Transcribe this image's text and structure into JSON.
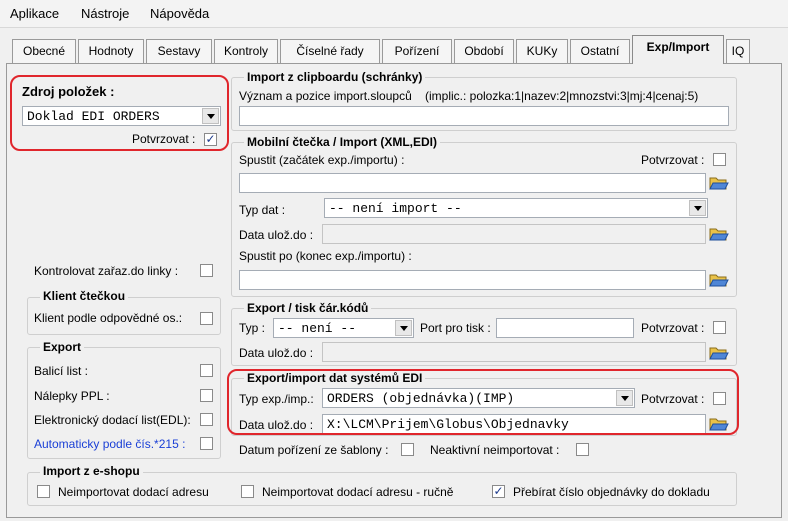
{
  "menu": {
    "items": [
      "Aplikace",
      "Nástroje",
      "Nápověda"
    ]
  },
  "tabs": [
    {
      "label": "Obecné"
    },
    {
      "label": "Hodnoty"
    },
    {
      "label": "Sestavy"
    },
    {
      "label": "Kontroly"
    },
    {
      "label": "Číselné řady"
    },
    {
      "label": "Pořízení"
    },
    {
      "label": "Období"
    },
    {
      "label": "KUKy"
    },
    {
      "label": "Ostatní"
    },
    {
      "label": "Exp/Import"
    },
    {
      "label": "IQ"
    }
  ],
  "zdroj": {
    "title": "Zdroj položek :",
    "value": "Doklad EDI ORDERS",
    "confirm_label": "Potvrzovat :",
    "confirm_checked": true
  },
  "left": {
    "kontrolovat_label": "Kontrolovat zařaz.do linky :",
    "klient": {
      "title": "Klient čtečkou",
      "option_label": "Klient podle odpovědné os.:"
    },
    "export": {
      "title": "Export",
      "items": [
        {
          "label": "Balicí list :"
        },
        {
          "label": "Nálepky PPL :"
        },
        {
          "label": "Elektronický dodací list(EDL):"
        },
        {
          "label": "Automaticky podle čís.*215 :"
        }
      ]
    }
  },
  "clipboard": {
    "title": "Import z clipboardu (schránky)",
    "desc": "Význam a pozice import.sloupců",
    "hint": "(implic.: polozka:1|nazev:2|mnozstvi:3|mj:4|cenaj:5)",
    "value": ""
  },
  "mobile": {
    "title": "Mobilní čtečka / Import (XML,EDI)",
    "start_label": "Spustit (začátek exp./importu) :",
    "confirm_label": "Potvrzovat :",
    "start_value": "",
    "type_label": "Typ dat :",
    "type_value": "-- není import --",
    "save_label": "Data ulož.do :",
    "save_value": "",
    "after_label": "Spustit po (konec exp./importu) :",
    "after_value": ""
  },
  "barcode": {
    "title": "Export / tisk čár.kódů",
    "type_label": "Typ :",
    "type_value": "-- není --",
    "port_label": "Port pro tisk :",
    "port_value": "",
    "confirm_label": "Potvrzovat :",
    "save_label": "Data ulož.do :",
    "save_value": ""
  },
  "edi": {
    "title": "Export/import dat systémů EDI",
    "type_label": "Typ exp./imp.:",
    "type_value": "ORDERS (objednávka)(IMP)",
    "confirm_label": "Potvrzovat :",
    "save_label": "Data ulož.do :",
    "save_value": "X:\\LCM\\Prijem\\Globus\\Objednavky"
  },
  "misc": {
    "datum_label": "Datum pořízení ze šablony :",
    "neaktivni_label": "Neaktivní neimportovat :"
  },
  "eshop": {
    "title": "Import z e-shopu",
    "options": [
      {
        "label": "Neimportovat dodací adresu",
        "checked": false
      },
      {
        "label": "Neimportovat dodací adresu - ručně",
        "checked": false
      },
      {
        "label": "Přebírat číslo objednávky do dokladu",
        "checked": true
      }
    ]
  },
  "colors": {
    "highlight": "#e0262c",
    "link_blue": "#1a3fd6",
    "check_mark": "#1c3a8c"
  }
}
